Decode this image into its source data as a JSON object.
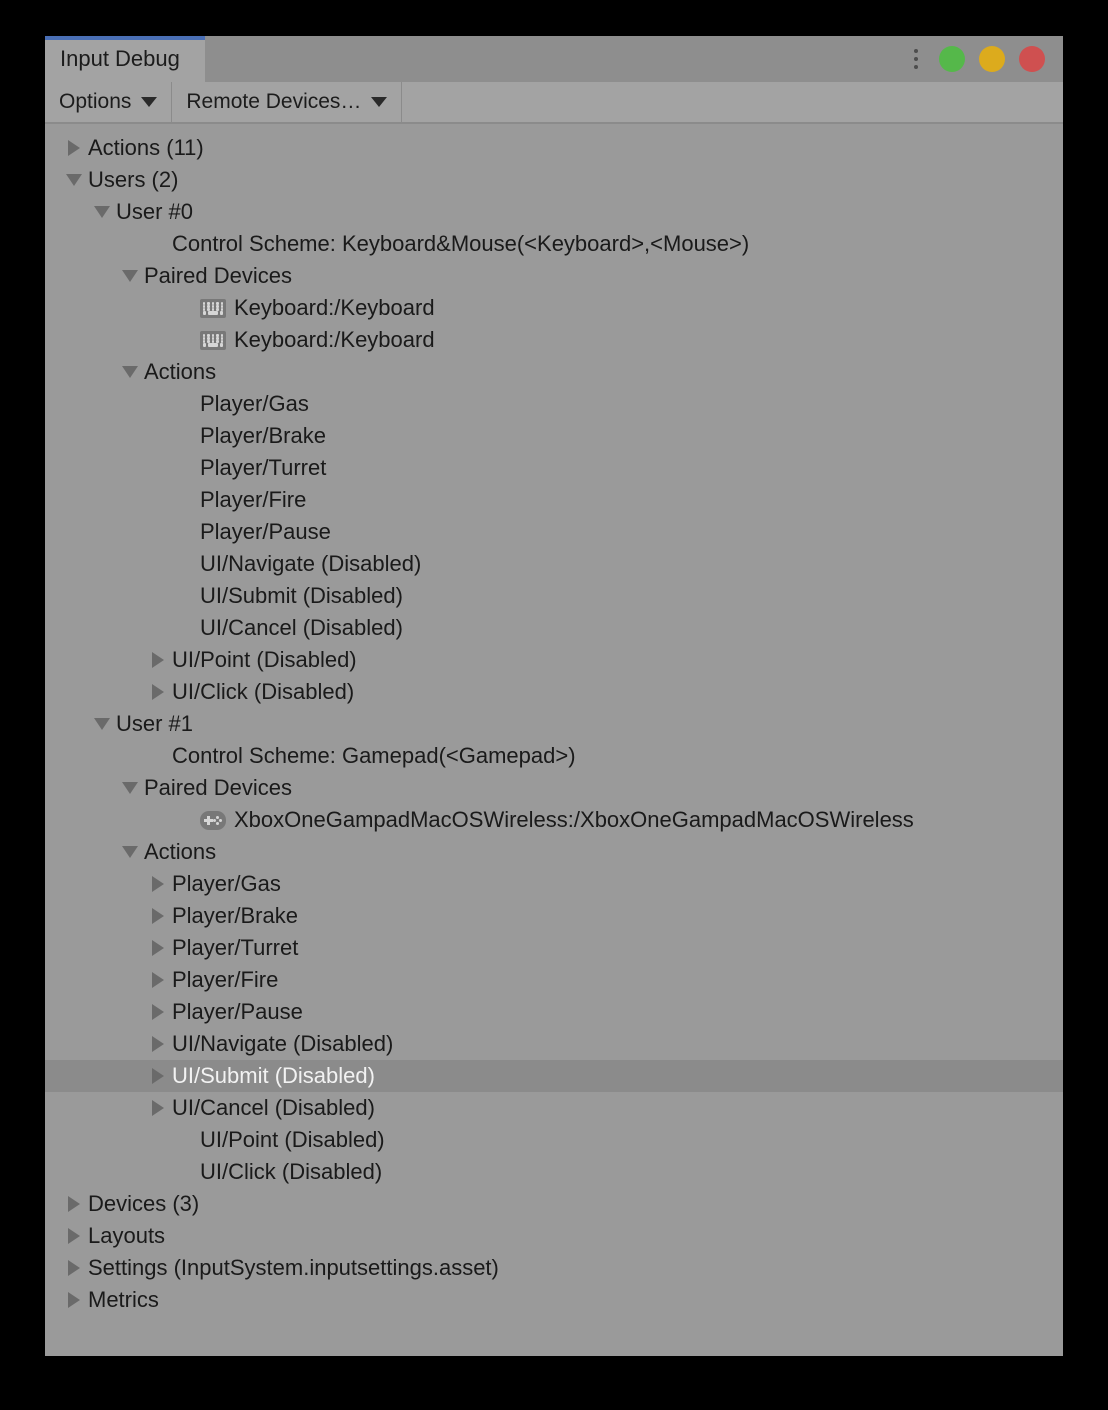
{
  "window": {
    "tab_label": "Input Debug",
    "controls": {
      "menu_icon": "kebab-menu-icon",
      "green_label": "",
      "yellow_label": "",
      "red_label": ""
    }
  },
  "toolbar": {
    "options_label": "Options",
    "remote_devices_label": "Remote Devices…"
  },
  "colors": {
    "window_background": "#9a9a9a",
    "titlebar_background": "#8e8e8e",
    "tab_background": "#a3a3a3",
    "toolbar_background": "#a3a3a3",
    "tab_accent": "#4a6fb5",
    "selection_background": "#8b8b8b",
    "text": "#1a1a1a",
    "selected_text": "#f2f2f2",
    "arrow": "#6a6a6a",
    "traffic_green": "#55b84a",
    "traffic_yellow": "#dcab1d",
    "traffic_red": "#cf5050"
  },
  "tree": [
    {
      "label": "Actions (11)",
      "indent": 0,
      "toggle": "collapsed",
      "icon": null,
      "selected": false
    },
    {
      "label": "Users (2)",
      "indent": 0,
      "toggle": "expanded",
      "icon": null,
      "selected": false
    },
    {
      "label": "User #0",
      "indent": 1,
      "toggle": "expanded",
      "icon": null,
      "selected": false
    },
    {
      "label": "Control Scheme: Keyboard&Mouse(<Keyboard>,<Mouse>)",
      "indent": 3,
      "toggle": "none",
      "icon": null,
      "selected": false
    },
    {
      "label": "Paired Devices",
      "indent": 2,
      "toggle": "expanded",
      "icon": null,
      "selected": false
    },
    {
      "label": "Keyboard:/Keyboard",
      "indent": 4,
      "toggle": "none",
      "icon": "keyboard-icon",
      "selected": false
    },
    {
      "label": "Keyboard:/Keyboard",
      "indent": 4,
      "toggle": "none",
      "icon": "keyboard-icon",
      "selected": false
    },
    {
      "label": "Actions",
      "indent": 2,
      "toggle": "expanded",
      "icon": null,
      "selected": false
    },
    {
      "label": "Player/Gas",
      "indent": 4,
      "toggle": "none",
      "icon": null,
      "selected": false
    },
    {
      "label": "Player/Brake",
      "indent": 4,
      "toggle": "none",
      "icon": null,
      "selected": false
    },
    {
      "label": "Player/Turret",
      "indent": 4,
      "toggle": "none",
      "icon": null,
      "selected": false
    },
    {
      "label": "Player/Fire",
      "indent": 4,
      "toggle": "none",
      "icon": null,
      "selected": false
    },
    {
      "label": "Player/Pause",
      "indent": 4,
      "toggle": "none",
      "icon": null,
      "selected": false
    },
    {
      "label": "UI/Navigate (Disabled)",
      "indent": 4,
      "toggle": "none",
      "icon": null,
      "selected": false
    },
    {
      "label": "UI/Submit (Disabled)",
      "indent": 4,
      "toggle": "none",
      "icon": null,
      "selected": false
    },
    {
      "label": "UI/Cancel (Disabled)",
      "indent": 4,
      "toggle": "none",
      "icon": null,
      "selected": false
    },
    {
      "label": "UI/Point (Disabled)",
      "indent": 3,
      "toggle": "collapsed",
      "icon": null,
      "selected": false
    },
    {
      "label": "UI/Click (Disabled)",
      "indent": 3,
      "toggle": "collapsed",
      "icon": null,
      "selected": false
    },
    {
      "label": "User #1",
      "indent": 1,
      "toggle": "expanded",
      "icon": null,
      "selected": false
    },
    {
      "label": "Control Scheme: Gamepad(<Gamepad>)",
      "indent": 3,
      "toggle": "none",
      "icon": null,
      "selected": false
    },
    {
      "label": "Paired Devices",
      "indent": 2,
      "toggle": "expanded",
      "icon": null,
      "selected": false
    },
    {
      "label": "XboxOneGampadMacOSWireless:/XboxOneGampadMacOSWireless",
      "indent": 4,
      "toggle": "none",
      "icon": "gamepad-icon",
      "selected": false
    },
    {
      "label": "Actions",
      "indent": 2,
      "toggle": "expanded",
      "icon": null,
      "selected": false
    },
    {
      "label": "Player/Gas",
      "indent": 3,
      "toggle": "collapsed",
      "icon": null,
      "selected": false
    },
    {
      "label": "Player/Brake",
      "indent": 3,
      "toggle": "collapsed",
      "icon": null,
      "selected": false
    },
    {
      "label": "Player/Turret",
      "indent": 3,
      "toggle": "collapsed",
      "icon": null,
      "selected": false
    },
    {
      "label": "Player/Fire",
      "indent": 3,
      "toggle": "collapsed",
      "icon": null,
      "selected": false
    },
    {
      "label": "Player/Pause",
      "indent": 3,
      "toggle": "collapsed",
      "icon": null,
      "selected": false
    },
    {
      "label": "UI/Navigate (Disabled)",
      "indent": 3,
      "toggle": "collapsed",
      "icon": null,
      "selected": false
    },
    {
      "label": "UI/Submit (Disabled)",
      "indent": 3,
      "toggle": "collapsed",
      "icon": null,
      "selected": true
    },
    {
      "label": "UI/Cancel (Disabled)",
      "indent": 3,
      "toggle": "collapsed",
      "icon": null,
      "selected": false
    },
    {
      "label": "UI/Point (Disabled)",
      "indent": 4,
      "toggle": "none",
      "icon": null,
      "selected": false
    },
    {
      "label": "UI/Click (Disabled)",
      "indent": 4,
      "toggle": "none",
      "icon": null,
      "selected": false
    },
    {
      "label": "Devices (3)",
      "indent": 0,
      "toggle": "collapsed",
      "icon": null,
      "selected": false
    },
    {
      "label": "Layouts",
      "indent": 0,
      "toggle": "collapsed",
      "icon": null,
      "selected": false
    },
    {
      "label": "Settings (InputSystem.inputsettings.asset)",
      "indent": 0,
      "toggle": "collapsed",
      "icon": null,
      "selected": false
    },
    {
      "label": "Metrics",
      "indent": 0,
      "toggle": "collapsed",
      "icon": null,
      "selected": false
    }
  ]
}
